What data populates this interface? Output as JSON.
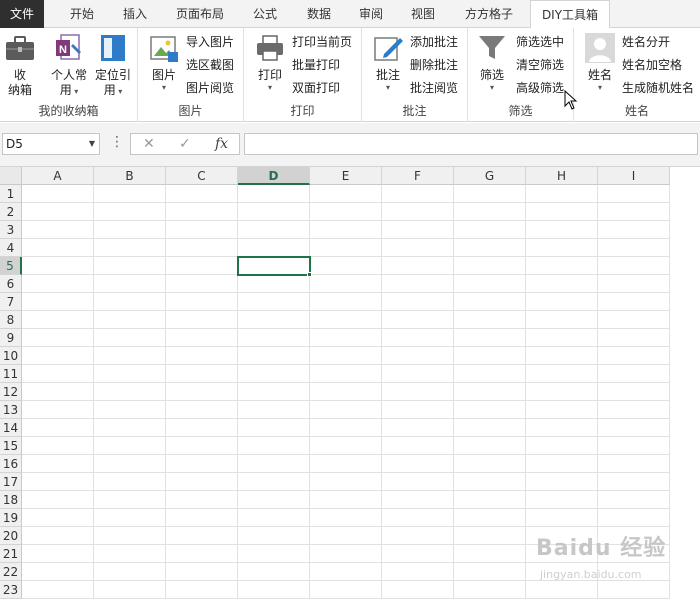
{
  "tabs": [
    {
      "label": "文件"
    },
    {
      "label": "开始"
    },
    {
      "label": "插入"
    },
    {
      "label": "页面布局"
    },
    {
      "label": "公式"
    },
    {
      "label": "数据"
    },
    {
      "label": "审阅"
    },
    {
      "label": "视图"
    },
    {
      "label": "方方格子"
    },
    {
      "label": "DIY工具箱"
    }
  ],
  "ribbon": {
    "groups": {
      "mybox": {
        "label": "我的收纳箱",
        "storage_label_1": "收",
        "storage_label_2": "纳箱",
        "personal_label_1": "个人常",
        "personal_label_2": "用",
        "locate_label_1": "定位引",
        "locate_label_2": "用"
      },
      "picture": {
        "label": "图片",
        "big_label": "图片",
        "import": "导入图片",
        "crop": "选区截图",
        "browse": "图片阅览"
      },
      "print": {
        "label": "打印",
        "big_label": "打印",
        "current": "打印当前页",
        "batch": "批量打印",
        "duplex": "双面打印"
      },
      "comment": {
        "label": "批注",
        "big_label": "批注",
        "add": "添加批注",
        "delete": "删除批注",
        "browse": "批注阅览"
      },
      "filter": {
        "label": "筛选",
        "big_label": "筛选",
        "filter_selected": "筛选选中",
        "clear": "清空筛选",
        "advanced": "高级筛选"
      },
      "name": {
        "label": "姓名",
        "big_label": "姓名",
        "split": "姓名分开",
        "add_space": "姓名加空格",
        "random": "生成随机姓名"
      }
    }
  },
  "formula_bar": {
    "name_box": "D5",
    "cancel_icon": "✕",
    "enter_icon": "✓",
    "fx_label": "fx",
    "formula": ""
  },
  "sheet": {
    "columns": [
      "A",
      "B",
      "C",
      "D",
      "E",
      "F",
      "G",
      "H",
      "I"
    ],
    "rows": [
      "1",
      "2",
      "3",
      "4",
      "5",
      "6",
      "7",
      "8",
      "9",
      "10",
      "11",
      "12",
      "13",
      "14",
      "15",
      "16",
      "17",
      "18",
      "19",
      "20",
      "21",
      "22",
      "23"
    ],
    "selected_column": "D",
    "selected_row": "5"
  },
  "watermark": {
    "text": "Baidu 经验",
    "sub": "jingyan.baidu.com"
  },
  "colors": {
    "accent": "#217346",
    "file_tab": "#2f2f2f"
  }
}
